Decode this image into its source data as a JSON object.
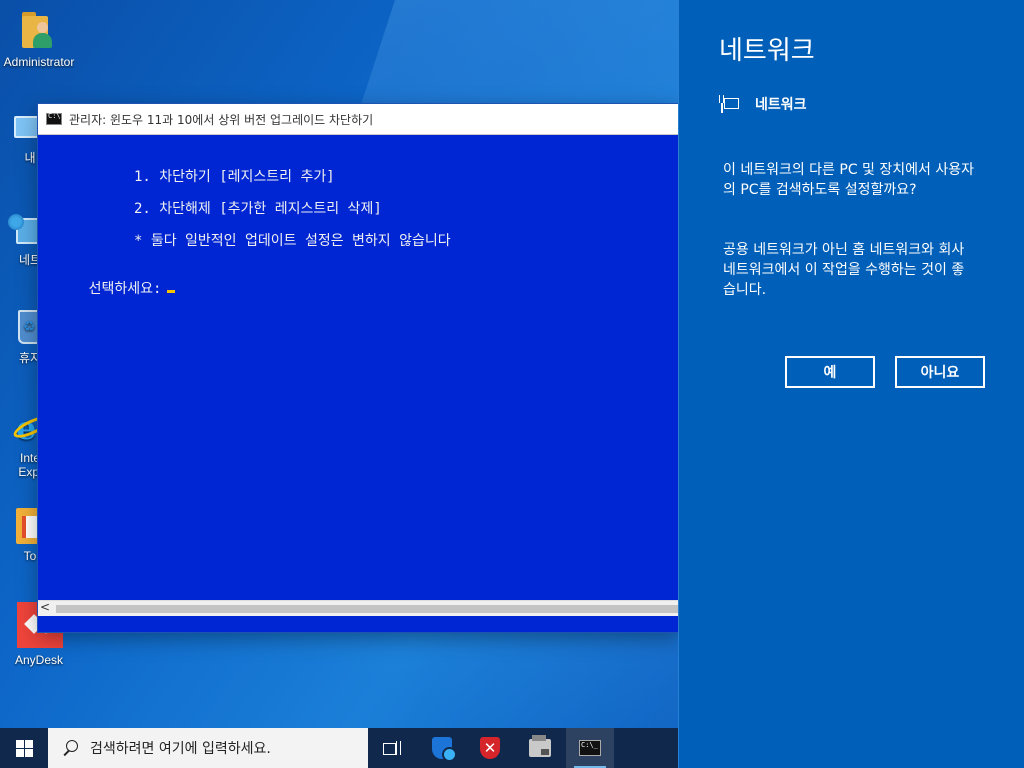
{
  "desktop": {
    "icons": [
      {
        "label": "Administrator"
      },
      {
        "label": "내"
      },
      {
        "label": "네트"
      },
      {
        "label": "휴지"
      },
      {
        "label": "Inte",
        "label2": "Expl"
      },
      {
        "label": "To"
      },
      {
        "label": "AnyDesk"
      }
    ]
  },
  "console": {
    "title": "관리자:  윈도우 11과 10에서 상위 버전 업그레이드 차단하기",
    "lines": [
      "1. 차단하기 [레지스트리 추가]",
      "2. 차단해제 [추가한 레지스트리 삭제]",
      "* 둘다 일반적인 업데이트 설정은 변하지 않습니다"
    ],
    "prompt": "선택하세요:",
    "scroll_left_arrow": "<"
  },
  "flyout": {
    "heading": "네트워크",
    "network_name": "네트워크",
    "question": "이 네트워크의 다른 PC 및 장치에서 사용자의 PC를 검색하도록 설정할까요?",
    "explanation": "공용 네트워크가 아닌 홈 네트워크와 회사 네트워크에서 이 작업을 수행하는 것이 좋습니다.",
    "yes_label": "예",
    "no_label": "아니요",
    "background_color": "#005fb8"
  },
  "taskbar": {
    "search_placeholder": "검색하려면 여기에 입력하세요.",
    "red_shield_mark": "✕",
    "background_color": "#10284b"
  }
}
